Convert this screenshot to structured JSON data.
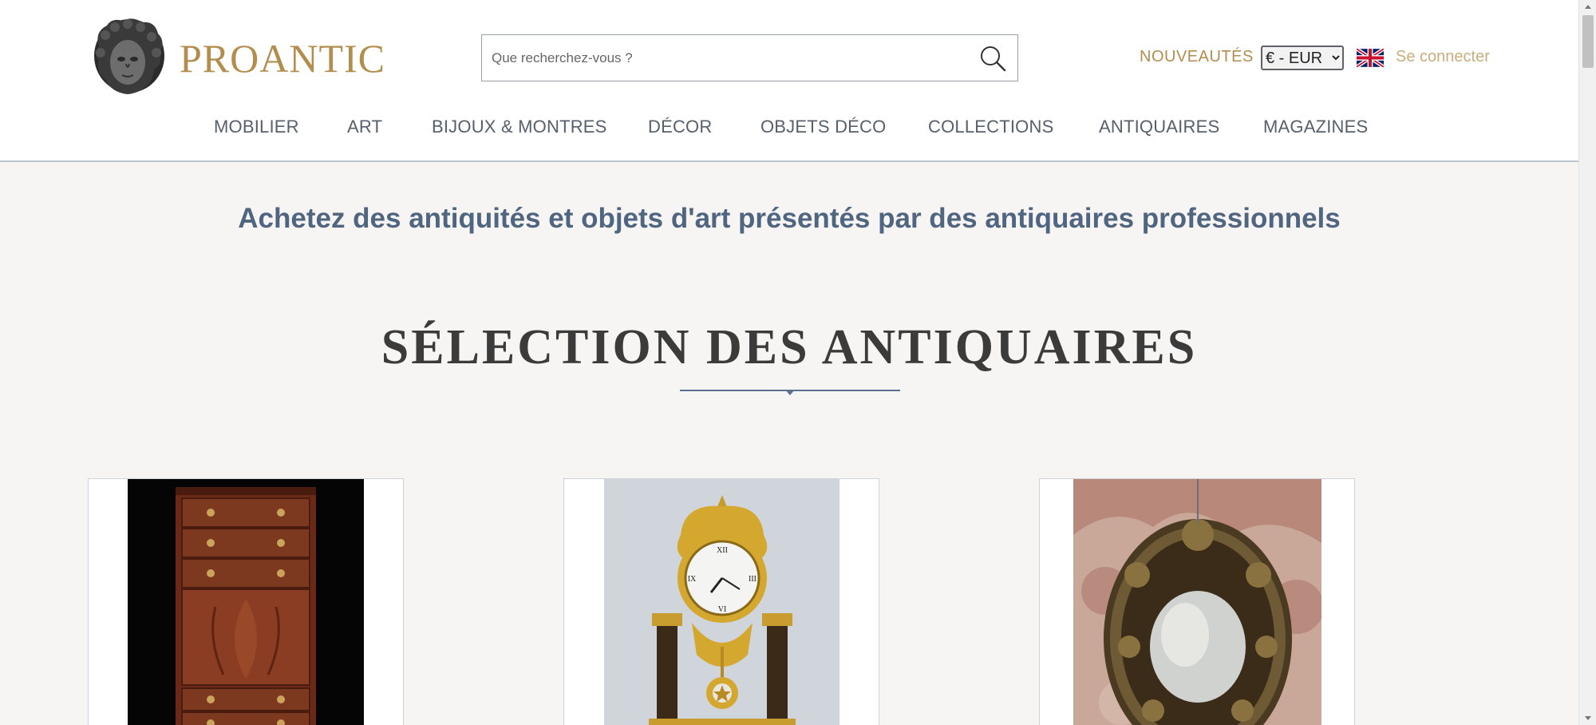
{
  "header": {
    "logo_text": "PROANTIC",
    "search_placeholder": "Que recherchez-vous ?",
    "new_label": "NOUVEAUTÉS",
    "currency_selected": "€ - EUR",
    "language_icon": "uk-flag-icon",
    "login_label": "Se connecter"
  },
  "nav": {
    "items": [
      {
        "label": "MOBILIER"
      },
      {
        "label": "ART"
      },
      {
        "label": "BIJOUX & MONTRES"
      },
      {
        "label": "DÉCOR"
      },
      {
        "label": "OBJETS DÉCO"
      },
      {
        "label": "COLLECTIONS"
      },
      {
        "label": "ANTIQUAIRES"
      },
      {
        "label": "MAGAZINES"
      }
    ]
  },
  "main": {
    "tagline": "Achetez des antiquités et objets d'art présentés par des antiquaires professionnels",
    "section_title": "SÉLECTION DES ANTIQUAIRES",
    "cards": [
      {
        "image": "mahogany-chest-of-drawers-image"
      },
      {
        "image": "gilt-bronze-portico-clock-image"
      },
      {
        "image": "carved-gilt-wood-mirror-image"
      }
    ]
  },
  "colors": {
    "brand_gold": "#b38d4e",
    "tagline_blue": "#4f6580",
    "background": "#f6f5f4"
  }
}
